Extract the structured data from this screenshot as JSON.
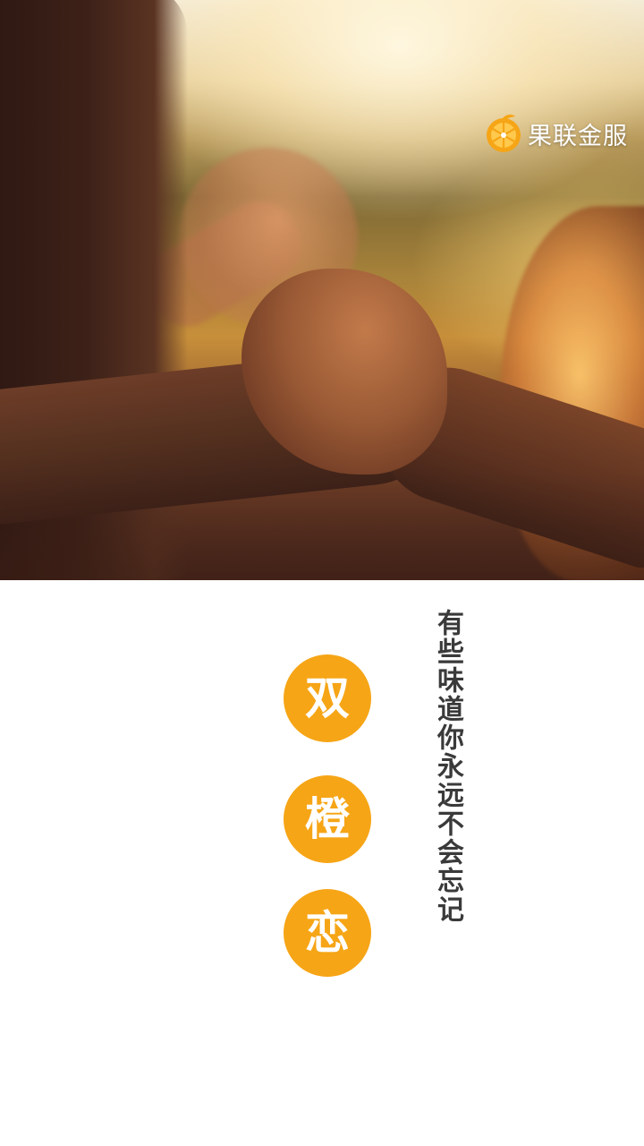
{
  "brand": {
    "name": "果联金服",
    "icon": "orange-slice-logo-icon",
    "accent": "#f6a516"
  },
  "hero": {
    "image": "couple-holding-hands-sunset-photo"
  },
  "title_chars": [
    "双",
    "橙",
    "恋"
  ],
  "tagline": "有些味道你永远不会忘记",
  "colors": {
    "circle": "#f6a516",
    "circle_text": "#ffffff",
    "tagline": "#3a3a3a",
    "background": "#ffffff"
  }
}
